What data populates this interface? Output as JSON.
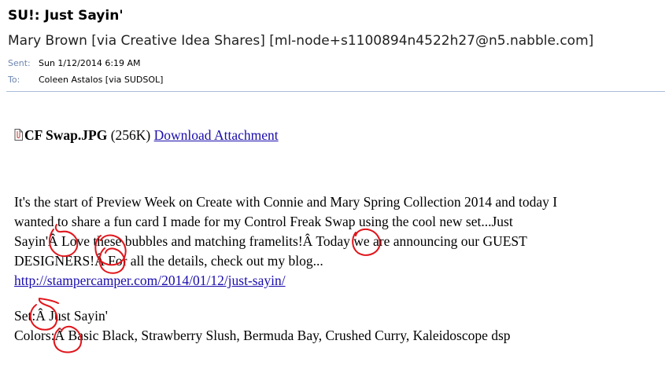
{
  "email": {
    "subject": "SU!: Just Sayin'",
    "from": "Mary Brown [via Creative Idea Shares] [ml-node+s1100894n4522h27@n5.nabble.com]",
    "sent_label": "Sent:",
    "sent_value": "Sun 1/12/2014 6:19 AM",
    "to_label": "To:",
    "to_value": "Coleen Astalos [via SUDSOL]"
  },
  "attachment": {
    "icon": "paperclip-document-icon",
    "name": "CF Swap.JPG",
    "size": "(256K)",
    "link_label": "Download Attachment"
  },
  "body": {
    "line1": "It's the start of Preview Week on Create with Connie and Mary Spring Collection 2014 and today I",
    "line2": "wanted to share a fun card I made for my Control Freak Swap using the cool new set...Just",
    "line3": "Sayin'Â  Love these bubbles and matching framelits!Â  Today we are announcing our GUEST",
    "line4": "DESIGNERS!Â  For all the details, check out my blog...",
    "link": "http://stampercamper.com/2014/01/12/just-sayin/",
    "set_line": "Set:Â  Just Sayin'",
    "colors_line": "Colors:Â  Basic Black, Strawberry Slush, Bermuda Bay, Crushed Curry, Kaleidoscope dsp"
  },
  "colors": {
    "meta_label": "#6d86b0",
    "separator": "#a9bcd8",
    "link": "#1a0dab",
    "annotation": "#e0151b"
  }
}
